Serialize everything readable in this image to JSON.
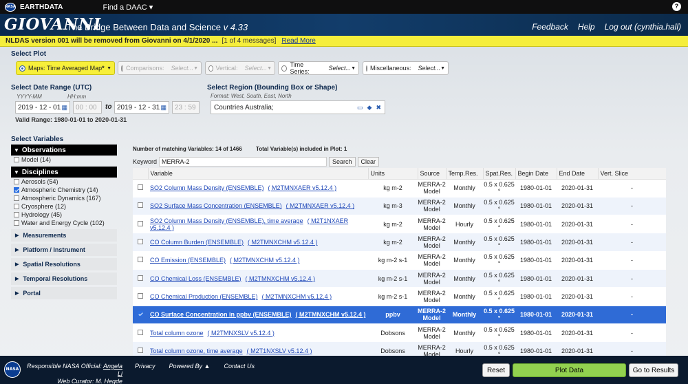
{
  "topbar": {
    "nasa_logo": "NASA",
    "earthdata": "EARTHDATA",
    "find_daac": "Find a DAAC ▾",
    "help": "?"
  },
  "header": {
    "logo": "GIOVANNI",
    "tagline": "The Bridge Between Data and Science",
    "version": "v 4.33",
    "feedback": "Feedback",
    "help": "Help",
    "logout": "Log out (cynthia.hall)"
  },
  "alert": {
    "message": "NLDAS version 001 will be removed from Giovanni on 4/1/2020 ...",
    "count": "[1 of 4 messages]",
    "read_more": "Read More"
  },
  "plot": {
    "section_label": "Select Plot",
    "maps": {
      "prefix": "Maps:",
      "value": "Time Averaged Map",
      "star": "*"
    },
    "comparisons": {
      "label": "Comparisons:",
      "placeholder": "Select..."
    },
    "vertical": {
      "label": "Vertical:",
      "placeholder": "Select..."
    },
    "timeseries": {
      "label": "Time Series:",
      "placeholder": "Select..."
    },
    "misc": {
      "label": "Miscellaneous:",
      "placeholder": "Select..."
    }
  },
  "date": {
    "section_label": "Select Date Range (UTC)",
    "hint_date": "YYYY-MM",
    "hint_time": "HH:mm",
    "start_date": "2019 - 12 - 01",
    "start_time": "00 : 00",
    "to": "to",
    "end_date": "2019 - 12 - 31",
    "end_time": "23 : 59",
    "valid_range": "Valid Range: 1980-01-01 to 2020-01-31"
  },
  "region": {
    "section_label": "Select Region (Bounding Box or Shape)",
    "format_hint": "Format: West, South, East, North",
    "value": "Countries Australia;"
  },
  "variables": {
    "section_label": "Select Variables",
    "observations_header": "Observations",
    "observations": [
      {
        "label": "Model (14)",
        "checked": false
      }
    ],
    "disciplines_header": "Disciplines",
    "disciplines": [
      {
        "label": "Aerosols (54)",
        "checked": false
      },
      {
        "label": "Atmospheric Chemistry (14)",
        "checked": true
      },
      {
        "label": "Atmospheric Dynamics (167)",
        "checked": false
      },
      {
        "label": "Cryosphere (12)",
        "checked": false
      },
      {
        "label": "Hydrology (45)",
        "checked": false
      },
      {
        "label": "Water and Energy Cycle (102)",
        "checked": false
      }
    ],
    "collapsed": [
      "Measurements",
      "Platform / Instrument",
      "Spatial Resolutions",
      "Temporal Resolutions",
      "Portal"
    ]
  },
  "results": {
    "matching": "Number of matching Variables: 14 of 1466",
    "included": "Total Variable(s) included in Plot: 1",
    "keyword_label": "Keyword",
    "keyword_value": "MERRA-2",
    "search": "Search",
    "clear": "Clear",
    "columns": [
      "Variable",
      "Units",
      "Source",
      "Temp.Res.",
      "Spat.Res.",
      "Begin Date",
      "End Date",
      "Vert. Slice"
    ],
    "rows": [
      {
        "name": "SO2 Column Mass Density (ENSEMBLE)",
        "product": "( M2TMNXAER v5.12.4 )",
        "units": "kg m-2",
        "source": "MERRA-2 Model",
        "temp": "Monthly",
        "spat": "0.5 x 0.625 °",
        "begin": "1980-01-01",
        "end": "2020-01-31",
        "vert": "-",
        "checked": false
      },
      {
        "name": "SO2 Surface Mass Concentration (ENSEMBLE)",
        "product": "( M2TMNXAER v5.12.4 )",
        "units": "kg m-3",
        "source": "MERRA-2 Model",
        "temp": "Monthly",
        "spat": "0.5 x 0.625 °",
        "begin": "1980-01-01",
        "end": "2020-01-31",
        "vert": "-",
        "checked": false
      },
      {
        "name": "SO2 Column Mass Density (ENSEMBLE), time average",
        "product": "( M2T1NXAER v5.12.4 )",
        "units": "kg m-2",
        "source": "MERRA-2 Model",
        "temp": "Hourly",
        "spat": "0.5 x 0.625 °",
        "begin": "1980-01-01",
        "end": "2020-01-31",
        "vert": "-",
        "checked": false
      },
      {
        "name": "CO Column Burden (ENSEMBLE)",
        "product": "( M2TMNXCHM v5.12.4 )",
        "units": "kg m-2",
        "source": "MERRA-2 Model",
        "temp": "Monthly",
        "spat": "0.5 x 0.625 °",
        "begin": "1980-01-01",
        "end": "2020-01-31",
        "vert": "-",
        "checked": false
      },
      {
        "name": "CO Emission (ENSEMBLE)",
        "product": "( M2TMNXCHM v5.12.4 )",
        "units": "kg m-2 s-1",
        "source": "MERRA-2 Model",
        "temp": "Monthly",
        "spat": "0.5 x 0.625 °",
        "begin": "1980-01-01",
        "end": "2020-01-31",
        "vert": "-",
        "checked": false
      },
      {
        "name": "CO Chemical Loss (ENSEMBLE)",
        "product": "( M2TMNXCHM v5.12.4 )",
        "units": "kg m-2 s-1",
        "source": "MERRA-2 Model",
        "temp": "Monthly",
        "spat": "0.5 x 0.625 °",
        "begin": "1980-01-01",
        "end": "2020-01-31",
        "vert": "-",
        "checked": false
      },
      {
        "name": "CO Chemical Production (ENSEMBLE)",
        "product": "( M2TMNXCHM v5.12.4 )",
        "units": "kg m-2 s-1",
        "source": "MERRA-2 Model",
        "temp": "Monthly",
        "spat": "0.5 x 0.625 °",
        "begin": "1980-01-01",
        "end": "2020-01-31",
        "vert": "-",
        "checked": false
      },
      {
        "name": "CO Surface Concentration in ppbv (ENSEMBLE)",
        "product": "( M2TMNXCHM v5.12.4 )",
        "units": "ppbv",
        "source": "MERRA-2 Model",
        "temp": "Monthly",
        "spat": "0.5 x 0.625 °",
        "begin": "1980-01-01",
        "end": "2020-01-31",
        "vert": "-",
        "checked": true
      },
      {
        "name": "Total column ozone",
        "product": "( M2TMNXSLV v5.12.4 )",
        "units": "Dobsons",
        "source": "MERRA-2 Model",
        "temp": "Monthly",
        "spat": "0.5 x 0.625 °",
        "begin": "1980-01-01",
        "end": "2020-01-31",
        "vert": "-",
        "checked": false
      },
      {
        "name": "Total column ozone, time average",
        "product": "( M2T1NXSLV v5.12.4 )",
        "units": "Dobsons",
        "source": "MERRA-2 Model",
        "temp": "Hourly",
        "spat": "0.5 x 0.625 °",
        "begin": "1980-01-01",
        "end": "2020-01-31",
        "vert": "-",
        "checked": false
      }
    ]
  },
  "footer": {
    "responsible_label": "Responsible NASA Official:",
    "responsible_name": "Angela Li",
    "curator_label": "Web Curator:",
    "curator_name": "M. Hegde",
    "privacy": "Privacy",
    "powered_by": "Powered By ▲",
    "contact": "Contact Us",
    "reset": "Reset",
    "plot": "Plot Data",
    "go_results": "Go to Results"
  },
  "colors": {
    "alert_bg": "#f5ee3c",
    "selected_row": "#2f6bd6",
    "plot_button": "#92d14f",
    "header_bg": "#123d6b"
  }
}
